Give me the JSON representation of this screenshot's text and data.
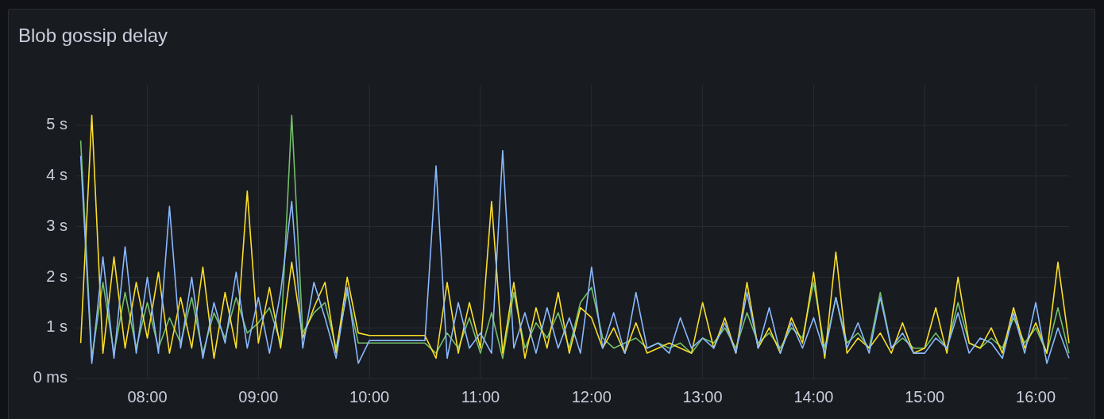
{
  "panel": {
    "title": "Blob gossip delay",
    "chart_data": {
      "type": "line",
      "x": [
        7.4,
        7.5,
        7.6,
        7.7,
        7.8,
        7.9,
        8.0,
        8.1,
        8.2,
        8.3,
        8.4,
        8.5,
        8.6,
        8.7,
        8.8,
        8.9,
        9.0,
        9.1,
        9.2,
        9.3,
        9.4,
        9.5,
        9.6,
        9.7,
        9.8,
        9.9,
        10.0,
        10.1,
        10.2,
        10.3,
        10.4,
        10.5,
        10.6,
        10.7,
        10.8,
        10.9,
        11.0,
        11.1,
        11.2,
        11.3,
        11.4,
        11.5,
        11.6,
        11.7,
        11.8,
        11.9,
        12.0,
        12.1,
        12.2,
        12.3,
        12.4,
        12.5,
        12.6,
        12.7,
        12.8,
        12.9,
        13.0,
        13.1,
        13.2,
        13.3,
        13.4,
        13.5,
        13.6,
        13.7,
        13.8,
        13.9,
        14.0,
        14.1,
        14.2,
        14.3,
        14.4,
        14.5,
        14.6,
        14.7,
        14.8,
        14.9,
        15.0,
        15.1,
        15.2,
        15.3,
        15.4,
        15.5,
        15.6,
        15.7,
        15.8,
        15.9,
        16.0,
        16.1,
        16.2,
        16.3
      ],
      "series": [
        {
          "color": "#73bf69",
          "values": [
            4.7,
            0.4,
            1.9,
            0.5,
            1.7,
            0.6,
            1.5,
            0.6,
            1.2,
            0.7,
            1.6,
            0.5,
            1.3,
            0.8,
            1.6,
            0.9,
            1.1,
            1.4,
            0.7,
            5.2,
            0.9,
            1.3,
            1.5,
            0.6,
            1.7,
            0.7,
            0.7,
            0.7,
            0.7,
            0.7,
            0.7,
            0.7,
            0.5,
            0.9,
            0.6,
            1.2,
            0.5,
            1.3,
            0.4,
            1.7,
            0.6,
            1.1,
            0.8,
            1.3,
            0.6,
            1.5,
            1.8,
            0.8,
            0.6,
            0.7,
            0.8,
            0.6,
            0.7,
            0.6,
            0.7,
            0.5,
            0.8,
            0.7,
            1.0,
            0.6,
            1.3,
            0.7,
            0.9,
            0.6,
            1.0,
            0.8,
            1.9,
            0.6,
            1.6,
            0.7,
            0.9,
            0.6,
            1.7,
            0.6,
            0.8,
            0.6,
            0.6,
            0.9,
            0.6,
            1.5,
            0.7,
            0.6,
            0.8,
            0.6,
            1.2,
            0.7,
            1.0,
            0.5,
            1.4,
            0.5
          ]
        },
        {
          "color": "#fade2a",
          "values": [
            0.7,
            5.2,
            0.5,
            2.4,
            0.6,
            1.9,
            0.8,
            2.1,
            0.5,
            1.6,
            0.6,
            2.2,
            0.4,
            1.7,
            0.6,
            3.7,
            0.7,
            1.8,
            0.6,
            2.3,
            0.8,
            1.4,
            1.9,
            0.5,
            2.0,
            0.9,
            0.85,
            0.85,
            0.85,
            0.85,
            0.85,
            0.85,
            0.4,
            1.9,
            0.5,
            1.5,
            0.6,
            3.5,
            0.5,
            1.9,
            0.4,
            1.4,
            0.6,
            1.7,
            0.5,
            1.4,
            1.2,
            0.6,
            1.0,
            0.5,
            1.1,
            0.5,
            0.6,
            0.7,
            0.6,
            0.5,
            1.5,
            0.6,
            1.2,
            0.5,
            1.9,
            0.6,
            1.0,
            0.5,
            1.2,
            0.7,
            2.1,
            0.4,
            2.5,
            0.5,
            0.8,
            0.6,
            0.9,
            0.5,
            1.1,
            0.5,
            0.6,
            1.4,
            0.5,
            2.0,
            0.7,
            0.6,
            1.0,
            0.5,
            1.4,
            0.6,
            1.1,
            0.5,
            2.3,
            0.7
          ]
        },
        {
          "color": "#8ab8ff",
          "values": [
            4.4,
            0.3,
            2.4,
            0.4,
            2.6,
            0.5,
            2.0,
            0.5,
            3.4,
            0.6,
            2.0,
            0.4,
            1.5,
            0.7,
            2.1,
            0.6,
            1.6,
            0.5,
            1.7,
            3.5,
            0.6,
            1.9,
            1.2,
            0.4,
            1.8,
            0.3,
            0.75,
            0.75,
            0.75,
            0.75,
            0.75,
            0.75,
            4.2,
            0.4,
            1.5,
            0.6,
            0.9,
            0.5,
            4.5,
            0.6,
            1.3,
            0.5,
            1.4,
            0.6,
            1.2,
            0.5,
            2.2,
            0.6,
            1.3,
            0.5,
            1.7,
            0.6,
            0.7,
            0.5,
            1.2,
            0.6,
            0.8,
            0.6,
            1.1,
            0.5,
            1.7,
            0.6,
            1.4,
            0.5,
            1.1,
            0.6,
            1.2,
            0.5,
            1.6,
            0.6,
            1.1,
            0.5,
            1.6,
            0.6,
            0.9,
            0.5,
            0.5,
            0.8,
            0.6,
            1.3,
            0.5,
            0.8,
            0.7,
            0.4,
            1.3,
            0.5,
            1.5,
            0.3,
            1.0,
            0.4
          ]
        }
      ],
      "grid": true,
      "xlim": [
        7.36,
        16.3
      ],
      "ylim": [
        0,
        5.8
      ],
      "xticks": [
        {
          "value": 8,
          "label": "08:00"
        },
        {
          "value": 9,
          "label": "09:00"
        },
        {
          "value": 10,
          "label": "10:00"
        },
        {
          "value": 11,
          "label": "11:00"
        },
        {
          "value": 12,
          "label": "12:00"
        },
        {
          "value": 13,
          "label": "13:00"
        },
        {
          "value": 14,
          "label": "14:00"
        },
        {
          "value": 15,
          "label": "15:00"
        },
        {
          "value": 16,
          "label": "16:00"
        }
      ],
      "yticks": [
        {
          "value": 0,
          "label": "0 ms"
        },
        {
          "value": 1,
          "label": "1 s"
        },
        {
          "value": 2,
          "label": "2 s"
        },
        {
          "value": 3,
          "label": "3 s"
        },
        {
          "value": 4,
          "label": "4 s"
        },
        {
          "value": 5,
          "label": "5 s"
        }
      ]
    }
  }
}
